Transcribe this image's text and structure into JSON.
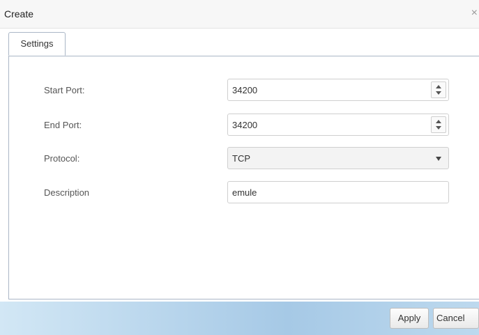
{
  "dialog": {
    "title": "Create",
    "close_glyph": "×"
  },
  "tabs": [
    {
      "label": "Settings",
      "active": true
    }
  ],
  "form": {
    "start_port": {
      "label": "Start Port:",
      "value": "34200"
    },
    "end_port": {
      "label": "End Port:",
      "value": "34200"
    },
    "protocol": {
      "label": "Protocol:",
      "value": "TCP"
    },
    "description": {
      "label": "Description",
      "value": "emule"
    }
  },
  "footer": {
    "apply_label": "Apply",
    "cancel_label": "Cancel"
  },
  "icons": [
    "close-icon",
    "spinner-up-icon",
    "spinner-down-icon",
    "chevron-down-icon"
  ],
  "colors": {
    "tab_border": "#aab6c6",
    "footer_gradient_start": "#d2e7f5",
    "footer_gradient_mid": "#a6c9e6"
  }
}
